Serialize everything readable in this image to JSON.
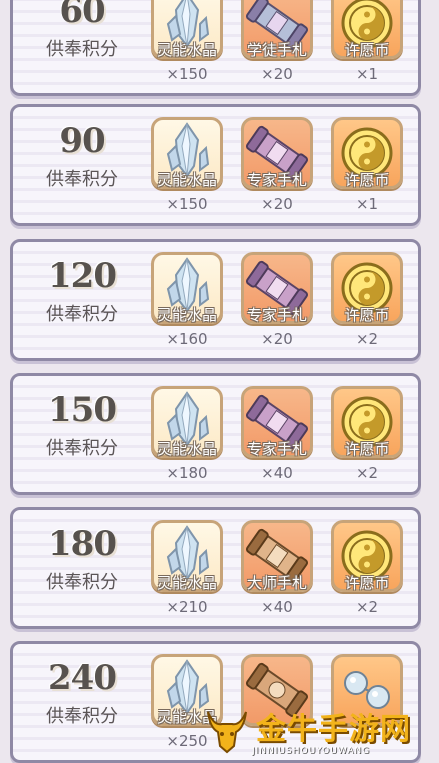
{
  "tiers": [
    {
      "points": "60",
      "points_label": "供奉积分",
      "rewards": [
        {
          "icon": "crystal-icon",
          "name": "灵能水晶",
          "qty": "×150"
        },
        {
          "icon": "scroll-icon",
          "name": "学徒手札",
          "qty": "×20"
        },
        {
          "icon": "yin-yang-coin-icon",
          "name": "许愿币",
          "qty": "×1"
        }
      ]
    },
    {
      "points": "90",
      "points_label": "供奉积分",
      "rewards": [
        {
          "icon": "crystal-icon",
          "name": "灵能水晶",
          "qty": "×150"
        },
        {
          "icon": "scroll-icon",
          "name": "专家手札",
          "qty": "×20"
        },
        {
          "icon": "yin-yang-coin-icon",
          "name": "许愿币",
          "qty": "×1"
        }
      ]
    },
    {
      "points": "120",
      "points_label": "供奉积分",
      "rewards": [
        {
          "icon": "crystal-icon",
          "name": "灵能水晶",
          "qty": "×160"
        },
        {
          "icon": "scroll-icon",
          "name": "专家手札",
          "qty": "×20"
        },
        {
          "icon": "yin-yang-coin-icon",
          "name": "许愿币",
          "qty": "×2"
        }
      ]
    },
    {
      "points": "150",
      "points_label": "供奉积分",
      "rewards": [
        {
          "icon": "crystal-icon",
          "name": "灵能水晶",
          "qty": "×180"
        },
        {
          "icon": "scroll-icon",
          "name": "专家手札",
          "qty": "×40"
        },
        {
          "icon": "yin-yang-coin-icon",
          "name": "许愿币",
          "qty": "×2"
        }
      ]
    },
    {
      "points": "180",
      "points_label": "供奉积分",
      "rewards": [
        {
          "icon": "crystal-icon",
          "name": "灵能水晶",
          "qty": "×210"
        },
        {
          "icon": "scroll-icon",
          "name": "大师手札",
          "qty": "×40"
        },
        {
          "icon": "yin-yang-coin-icon",
          "name": "许愿币",
          "qty": "×2"
        }
      ]
    },
    {
      "points": "240",
      "points_label": "供奉积分",
      "rewards": [
        {
          "icon": "crystal-icon",
          "name": "灵能水晶",
          "qty": "×250"
        },
        {
          "icon": "scroll-icon",
          "name": "",
          "qty": ""
        },
        {
          "icon": "orb-icon",
          "name": "",
          "qty": ""
        }
      ]
    }
  ],
  "watermark": {
    "title": "金牛手游网",
    "subtitle": "JINNIUSHOUYOUWANG"
  },
  "colors": {
    "frame": "#8f89a5",
    "slot_border": "#c7a479",
    "crystal_slot": "#fce9c6",
    "orange_slot": "#f29a68"
  }
}
